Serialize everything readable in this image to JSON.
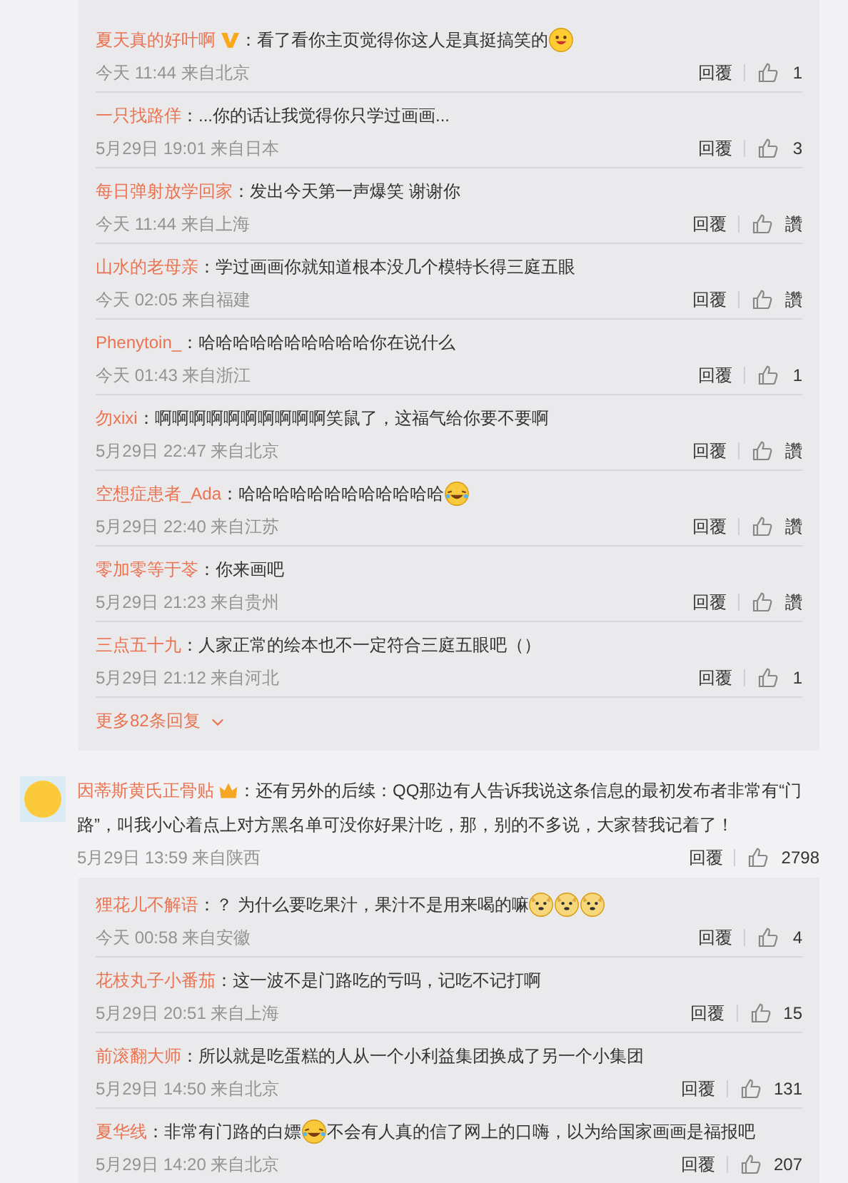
{
  "top_thread": {
    "replies": [
      {
        "user": "夏天真的好叶啊",
        "badge": {
          "kind": "verified"
        },
        "content": [
          {
            "kind": "text",
            "text": "：看了看你主页觉得你这人是真挺搞笑的"
          },
          {
            "kind": "emoji_grin"
          }
        ],
        "meta": "今天 11:44 来自北京",
        "reply_label": "回覆",
        "likes": "1"
      },
      {
        "user": "一只找路佯",
        "content": [
          {
            "kind": "text",
            "text": "：...你的话让我觉得你只学过画画..."
          }
        ],
        "meta": "5月29日 19:01 来自日本",
        "reply_label": "回覆",
        "likes": "3"
      },
      {
        "user": "每日弹射放学回家",
        "content": [
          {
            "kind": "text",
            "text": "：发出今天第一声爆笑 谢谢你"
          }
        ],
        "meta": "今天 11:44 来自上海",
        "reply_label": "回覆",
        "likes": "讚"
      },
      {
        "user": "山水的老母亲",
        "content": [
          {
            "kind": "text",
            "text": "：学过画画你就知道根本没几个模特长得三庭五眼"
          }
        ],
        "meta": "今天 02:05 来自福建",
        "reply_label": "回覆",
        "likes": "讚"
      },
      {
        "user": "Phenytoin_",
        "content": [
          {
            "kind": "text",
            "text": "：哈哈哈哈哈哈哈哈哈哈你在说什么"
          }
        ],
        "meta": "今天 01:43 来自浙江",
        "reply_label": "回覆",
        "likes": "1"
      },
      {
        "user": "勿xixi",
        "content": [
          {
            "kind": "text",
            "text": "：啊啊啊啊啊啊啊啊啊啊笑鼠了，这福气给你要不要啊"
          }
        ],
        "meta": "5月29日 22:47 来自北京",
        "reply_label": "回覆",
        "likes": "讚"
      },
      {
        "user": "空想症患者_Ada",
        "content": [
          {
            "kind": "text",
            "text": "：哈哈哈哈哈哈哈哈哈哈哈哈"
          },
          {
            "kind": "emoji_laugh_cry"
          }
        ],
        "meta": "5月29日 22:40 来自江苏",
        "reply_label": "回覆",
        "likes": "讚"
      },
      {
        "user": "零加零等于苓",
        "content": [
          {
            "kind": "text",
            "text": "：你来画吧"
          }
        ],
        "meta": "5月29日 21:23 来自贵州",
        "reply_label": "回覆",
        "likes": "讚"
      },
      {
        "user": "三点五十九",
        "content": [
          {
            "kind": "text",
            "text": "：人家正常的绘本也不一定符合三庭五眼吧（）"
          }
        ],
        "meta": "5月29日 21:12 来自河北",
        "reply_label": "回覆",
        "likes": "1"
      }
    ],
    "more_link": "更多82条回复"
  },
  "comment": {
    "user": "因蒂斯黄氏正骨贴",
    "badge": {
      "kind": "crown"
    },
    "content": [
      {
        "kind": "text",
        "text": "：还有另外的后续：QQ那边有人告诉我说这条信息的最初发布者非常有“门"
      },
      {
        "kind": "line",
        "text": "路”，叫我小心着点上对方黑名单可没你好果汁吃，那，别的不多说，大家替我记着了！"
      }
    ],
    "meta": "5月29日 13:59 来自陕西",
    "reply_label": "回覆",
    "likes": "2798",
    "replies": [
      {
        "user": "狸花儿不解语",
        "content": [
          {
            "kind": "text",
            "text": "：？ 为什么要吃果汁，果汁不是用来喝的嘛"
          },
          {
            "kind": "emoji_dog"
          },
          {
            "kind": "emoji_dog"
          },
          {
            "kind": "emoji_dog"
          }
        ],
        "meta": "今天 00:58 来自安徽",
        "reply_label": "回覆",
        "likes": "4"
      },
      {
        "user": "花枝丸子小番茄",
        "content": [
          {
            "kind": "text",
            "text": "：这一波不是门路吃的亏吗，记吃不记打啊"
          }
        ],
        "meta": "5月29日 20:51 来自上海",
        "reply_label": "回覆",
        "likes": "15"
      },
      {
        "user": "前滚翻大师",
        "content": [
          {
            "kind": "text",
            "text": "：所以就是吃蛋糕的人从一个小利益集团换成了另一个小集团"
          }
        ],
        "meta": "5月29日 14:50 来自北京",
        "reply_label": "回覆",
        "likes": "131"
      },
      {
        "user": "夏华线",
        "content": [
          {
            "kind": "text",
            "text": "：非常有门路的白嫖"
          },
          {
            "kind": "emoji_laugh_cry"
          },
          {
            "kind": "text",
            "text": "不会有人真的信了网上的口嗨，以为给国家画画是福报吧"
          }
        ],
        "meta": "5月29日 14:20 来自北京",
        "reply_label": "回覆",
        "likes": "207"
      }
    ]
  }
}
